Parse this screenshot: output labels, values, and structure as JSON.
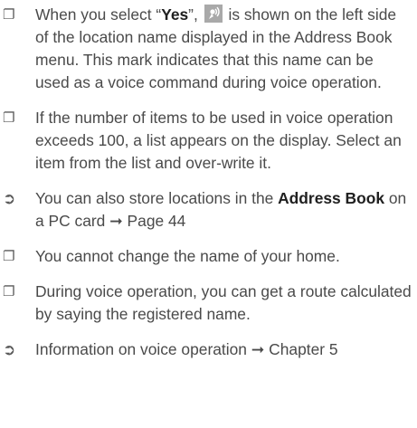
{
  "items": [
    {
      "bullet": "❐",
      "text_1": "When you select “",
      "bold_1": "Yes",
      "text_2": "”, ",
      "icon": "voice-command-icon",
      "text_3": " is shown on the left side of the location name displayed in the Address Book menu. This mark indicates that this name can be used as a voice command during voice operation."
    },
    {
      "bullet": "❐",
      "text": "If the number of items to be used in voice operation exceeds 100, a list appears on the display. Select an item from the list and over-write it."
    },
    {
      "bullet": "➲",
      "text_1": "You can also store locations in the ",
      "bold_1": "Address Book",
      "text_2": " on a PC card ➞ Page 44"
    },
    {
      "bullet": "❐",
      "text": "You cannot change the name of your home."
    },
    {
      "bullet": "❐",
      "text": "During voice operation, you can get a route calculated by saying the registered name."
    },
    {
      "bullet": "➲",
      "text": "Information on voice operation ➞ Chapter 5"
    }
  ]
}
